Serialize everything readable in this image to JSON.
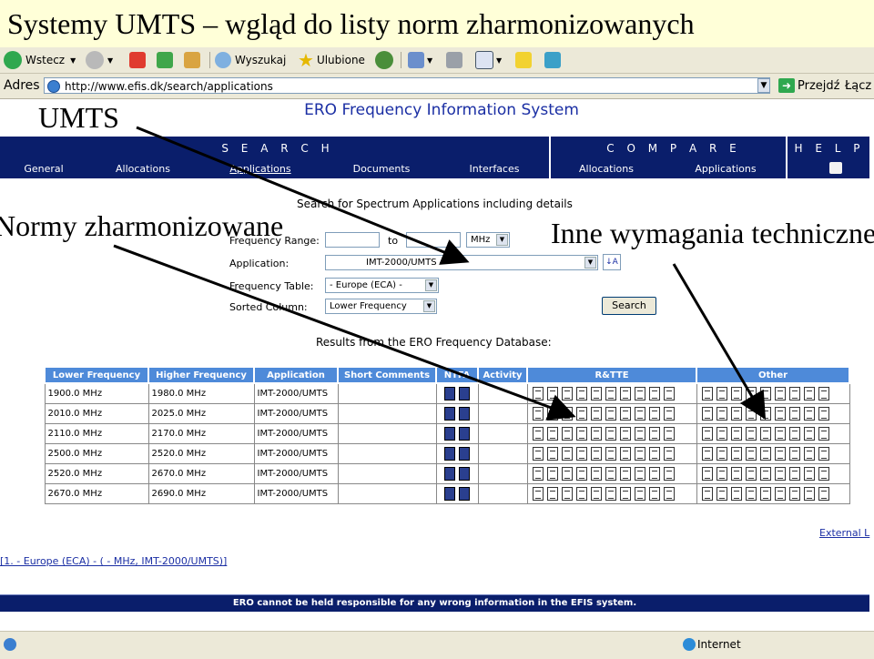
{
  "slide": {
    "title": "Systemy UMTS – wgląd do listy norm zharmonizowanych",
    "annotations": {
      "umts": "UMTS",
      "harmonized": "Normy zharmonizowane",
      "other_requirements": "Inne wymagania techniczne"
    }
  },
  "browser": {
    "toolbar": {
      "back": "Wstecz",
      "search": "Wyszukaj",
      "favorites": "Ulubione"
    },
    "address": {
      "label": "Adres",
      "url": "http://www.efis.dk/search/applications",
      "go": "Przejdź",
      "links": "Łącz"
    },
    "status": {
      "zone": "Internet"
    }
  },
  "site": {
    "title": "ERO Frequency Information System",
    "nav": {
      "search_heading": "S E A R C H",
      "compare_heading": "C O M P A R E",
      "help_heading": "H E L P",
      "search_items": [
        "General",
        "Allocations",
        "Applications",
        "Documents",
        "Interfaces"
      ],
      "compare_items": [
        "Allocations",
        "Applications"
      ]
    }
  },
  "form": {
    "heading": "Search for Spectrum Applications including details",
    "frequency_range_label": "Frequency Range:",
    "to_label": "to",
    "unit": "MHz",
    "application_label": "Application:",
    "application_value": "IMT-2000/UMTS",
    "frequency_table_label": "Frequency Table:",
    "frequency_table_value": "- Europe (ECA) -",
    "sorted_column_label": "Sorted Column:",
    "sorted_column_value": "Lower Frequency",
    "search_button": "Search"
  },
  "results": {
    "heading": "Results from the ERO Frequency Database:",
    "columns": [
      "Lower Frequency",
      "Higher Frequency",
      "Application",
      "Short Comments",
      "NTFA",
      "Activity",
      "R&TTE",
      "Other"
    ],
    "rows": [
      {
        "lower": "1900.0 MHz",
        "higher": "1980.0 MHz",
        "application": "IMT-2000/UMTS"
      },
      {
        "lower": "2010.0 MHz",
        "higher": "2025.0 MHz",
        "application": "IMT-2000/UMTS"
      },
      {
        "lower": "2110.0 MHz",
        "higher": "2170.0 MHz",
        "application": "IMT-2000/UMTS"
      },
      {
        "lower": "2500.0 MHz",
        "higher": "2520.0 MHz",
        "application": "IMT-2000/UMTS"
      },
      {
        "lower": "2520.0 MHz",
        "higher": "2670.0 MHz",
        "application": "IMT-2000/UMTS"
      },
      {
        "lower": "2670.0 MHz",
        "higher": "2690.0 MHz",
        "application": "IMT-2000/UMTS"
      }
    ],
    "rtte_docs_per_row": 10,
    "other_docs_per_row": 9,
    "ntfa_docs_per_row": 2
  },
  "footer": {
    "external_link": "External L",
    "query_link": "[1. - Europe (ECA) - ( - MHz, IMT-2000/UMTS)]",
    "disclaimer": "ERO cannot be held responsible for any wrong information in the EFIS system."
  }
}
